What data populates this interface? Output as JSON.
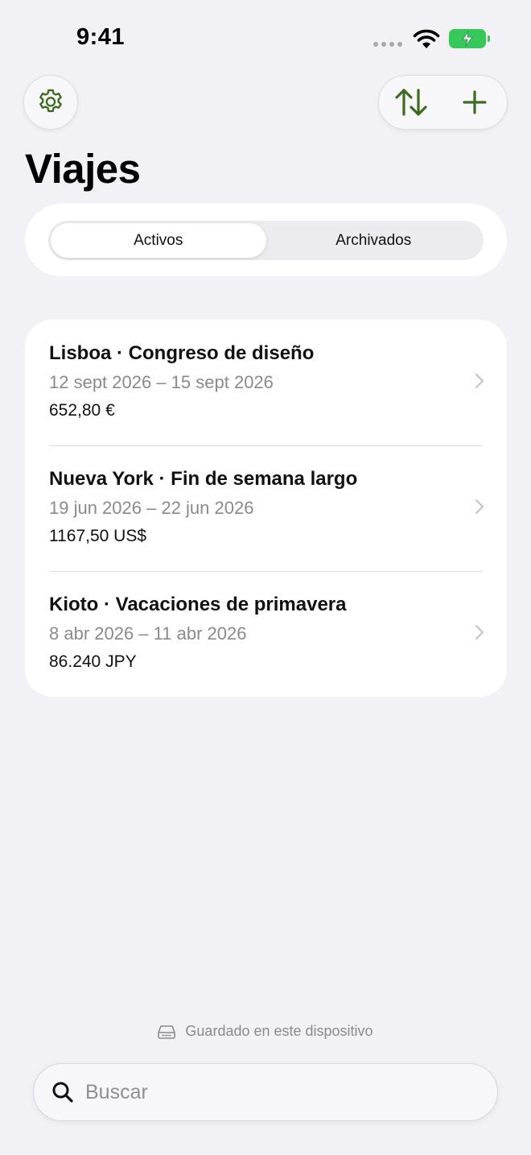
{
  "status_bar": {
    "time": "9:41"
  },
  "header": {
    "title": "Viajes",
    "settings_icon": "gear-icon",
    "sort_icon": "sort-arrows-icon",
    "add_icon": "plus-icon"
  },
  "segments": [
    {
      "label": "Activos",
      "selected": true
    },
    {
      "label": "Archivados",
      "selected": false
    }
  ],
  "trips": [
    {
      "title": "Lisboa · Congreso de diseño",
      "dates": "12 sept 2026 – 15 sept 2026",
      "amount": "652,80 €"
    },
    {
      "title": "Nueva York · Fin de semana largo",
      "dates": "19 jun 2026 – 22 jun 2026",
      "amount": "1167,50 US$"
    },
    {
      "title": "Kioto · Vacaciones de primavera",
      "dates": "8 abr 2026 – 11 abr 2026",
      "amount": "86.240 JPY"
    }
  ],
  "footer": {
    "storage_note": "Guardado en este dispositivo"
  },
  "search": {
    "placeholder": "Buscar",
    "value": ""
  },
  "colors": {
    "accent": "#3f6b1e",
    "background": "#f1f1f6",
    "battery": "#37c75a"
  }
}
